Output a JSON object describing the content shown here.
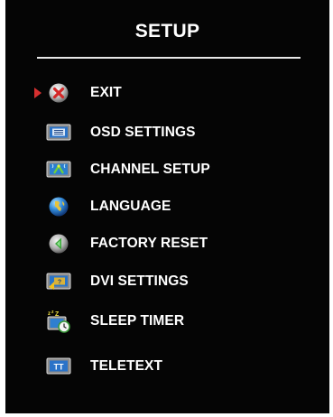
{
  "menu": {
    "title": "SETUP",
    "items": [
      {
        "label": "EXIT",
        "icon": "exit-icon",
        "selected": true
      },
      {
        "label": "OSD SETTINGS",
        "icon": "osd-settings-icon",
        "selected": false
      },
      {
        "label": "CHANNEL SETUP",
        "icon": "channel-setup-icon",
        "selected": false
      },
      {
        "label": "LANGUAGE",
        "icon": "language-globe-icon",
        "selected": false
      },
      {
        "label": "FACTORY RESET",
        "icon": "factory-reset-icon",
        "selected": false
      },
      {
        "label": "DVI SETTINGS",
        "icon": "dvi-settings-icon",
        "selected": false
      },
      {
        "label": "SLEEP TIMER",
        "icon": "sleep-timer-icon",
        "selected": false
      },
      {
        "label": "TELETEXT",
        "icon": "teletext-icon",
        "selected": false
      }
    ]
  },
  "colors": {
    "background": "#050505",
    "text": "#ffffff",
    "pointer": "#d63030"
  }
}
